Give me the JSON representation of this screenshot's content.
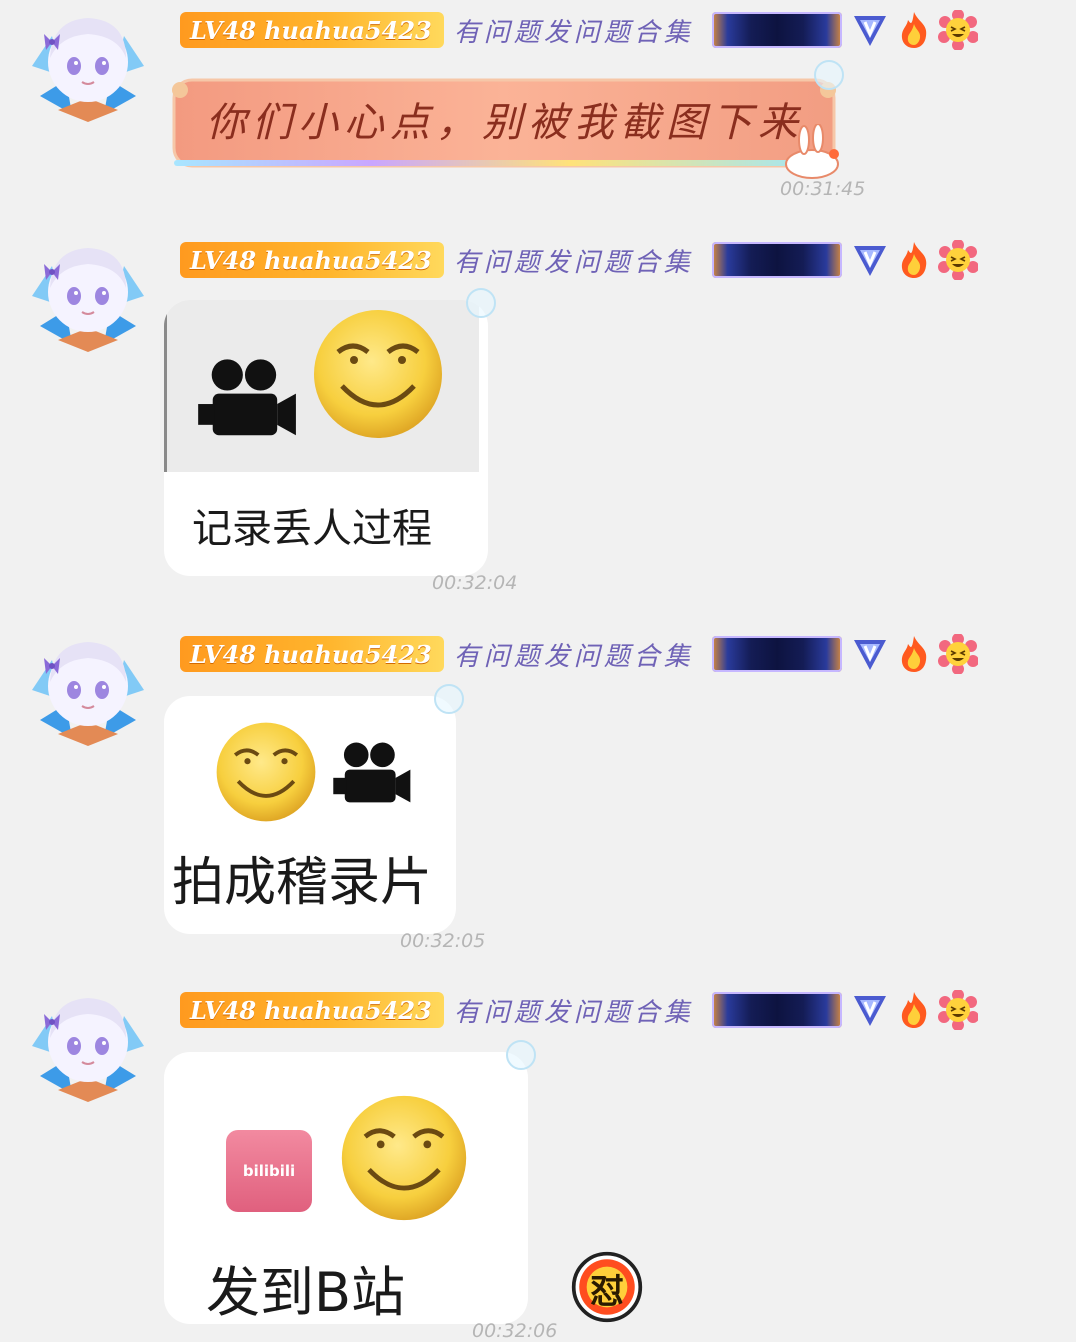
{
  "messages": [
    {
      "level": "LV48",
      "username": "huahua5423",
      "group_title": "有问题发问题合集",
      "content_type": "text",
      "text": "你们小心点，别被我截图下来",
      "time": "00:31:45"
    },
    {
      "level": "LV48",
      "username": "huahua5423",
      "group_title": "有问题发问题合集",
      "content_type": "sticker",
      "caption": "记录丢人过程",
      "time": "00:32:04"
    },
    {
      "level": "LV48",
      "username": "huahua5423",
      "group_title": "有问题发问题合集",
      "content_type": "sticker",
      "caption": "拍成稽录片",
      "time": "00:32:05"
    },
    {
      "level": "LV48",
      "username": "huahua5423",
      "group_title": "有问题发问题合集",
      "content_type": "sticker",
      "caption": "发到B站",
      "logo_text": "bilibili",
      "time": "00:32:06",
      "reaction_text": "怼"
    }
  ],
  "icons": {
    "avatar": "anime-girl-avatar-icon",
    "deco_strip": "honor-badge-strip-icon",
    "v_badge": "v-badge-icon",
    "flame": "flame-icon",
    "emoji": "laughing-emoji-icon",
    "camera": "video-camera-icon",
    "smile": "sly-smile-emoji-icon",
    "reaction": "dui-reaction-icon"
  },
  "colors": {
    "background": "#f1f1f1",
    "level_badge": "#ffa529",
    "group_title": "#6f62b6",
    "bubble_fill": "#f7a28a",
    "time_text": "#b5b5b5"
  }
}
